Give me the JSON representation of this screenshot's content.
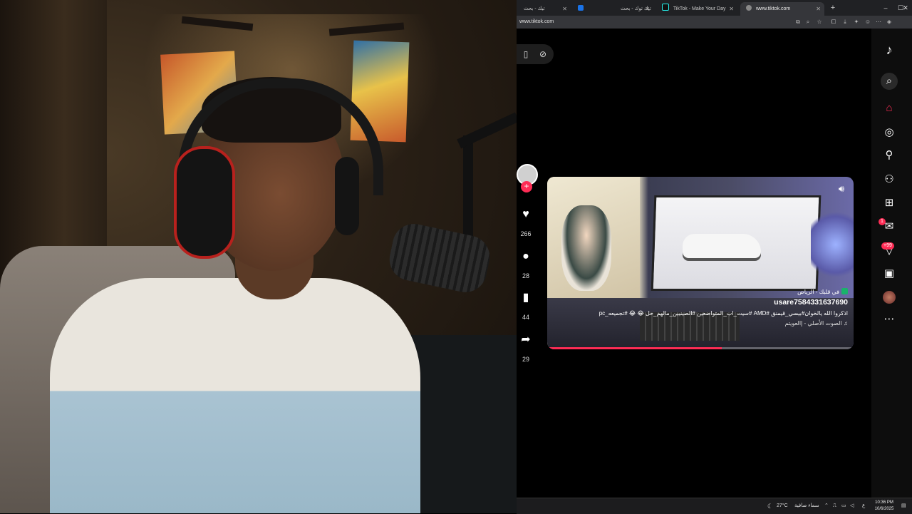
{
  "browser": {
    "tabs": [
      {
        "label": "تيك - بحث",
        "active": false
      },
      {
        "label": "",
        "active": false
      },
      {
        "label": "تيك توك - بحث",
        "active": false
      },
      {
        "label": "TikTok - Make Your Day",
        "active": false
      },
      {
        "label": "www.tiktok.com",
        "active": true
      }
    ],
    "new_tab": "+",
    "window_controls": {
      "minimize": "–",
      "maximize": "☐",
      "close": "✕"
    },
    "url": "www.tiktok.com"
  },
  "video": {
    "location": "في قلبك - الرياض",
    "username": "usare7584331637690",
    "caption": "اذكروا الله يالخوان#بيسي_قيمنق #AMD #سيت_اب_المتواضعين #الصينيين_مالهم_حل 😂 😂 #تجميعه_pc",
    "sound": "♫ الصوت الأصلي - إالعويتم",
    "progress": 0.57
  },
  "actions": {
    "likes": "266",
    "comments": "28",
    "saves": "44",
    "shares": "29"
  },
  "sidebar": {
    "messages_badge": "1",
    "inbox_badge": "+99"
  },
  "taskbar": {
    "temperature": "27°C",
    "weather": "سماء صافية",
    "lang": "ع",
    "time": "10:36 PM",
    "date": "10/6/2025"
  },
  "colors": {
    "accent": "#fe2c55",
    "tiktok_cyan": "#25f4ee"
  }
}
